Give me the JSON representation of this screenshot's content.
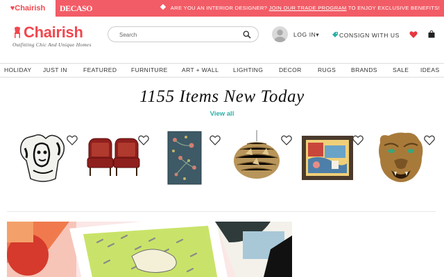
{
  "topbar": {
    "brand_primary": "Chairish",
    "brand_secondary": "DECASO",
    "promo_prefix": "ARE YOU AN INTERIOR DESIGNER?",
    "promo_link": "JOIN OUR TRADE PROGRAM",
    "promo_suffix": "TO ENJOY EXCLUSIVE BENEFITS!",
    "bg_color": "#f25c66"
  },
  "header": {
    "logo": "Chairish",
    "tagline": "Outfitting Chic And Unique Homes",
    "search_placeholder": "Search",
    "login_label": "LOG IN▾",
    "consign_label": "CONSIGN WITH US",
    "icons": [
      "avatar-icon",
      "tag-icon",
      "heart-icon",
      "bag-icon",
      "search-icon"
    ]
  },
  "nav": {
    "items": [
      "HOLIDAY",
      "JUST IN",
      "FEATURED",
      "FURNITURE",
      "ART + WALL",
      "LIGHTING",
      "DECOR",
      "RUGS",
      "BRANDS",
      "SALE",
      "IDEAS"
    ]
  },
  "feature": {
    "headline": "1155 Items New Today",
    "view_all": "View all",
    "accent_color": "#2bb0a8"
  },
  "products": [
    {
      "name": "bust-sculpture"
    },
    {
      "name": "red-leather-wingback-chairs"
    },
    {
      "name": "floral-textile-panel"
    },
    {
      "name": "brass-pendant-lamp"
    },
    {
      "name": "framed-painting"
    },
    {
      "name": "brass-tiger-head"
    }
  ]
}
